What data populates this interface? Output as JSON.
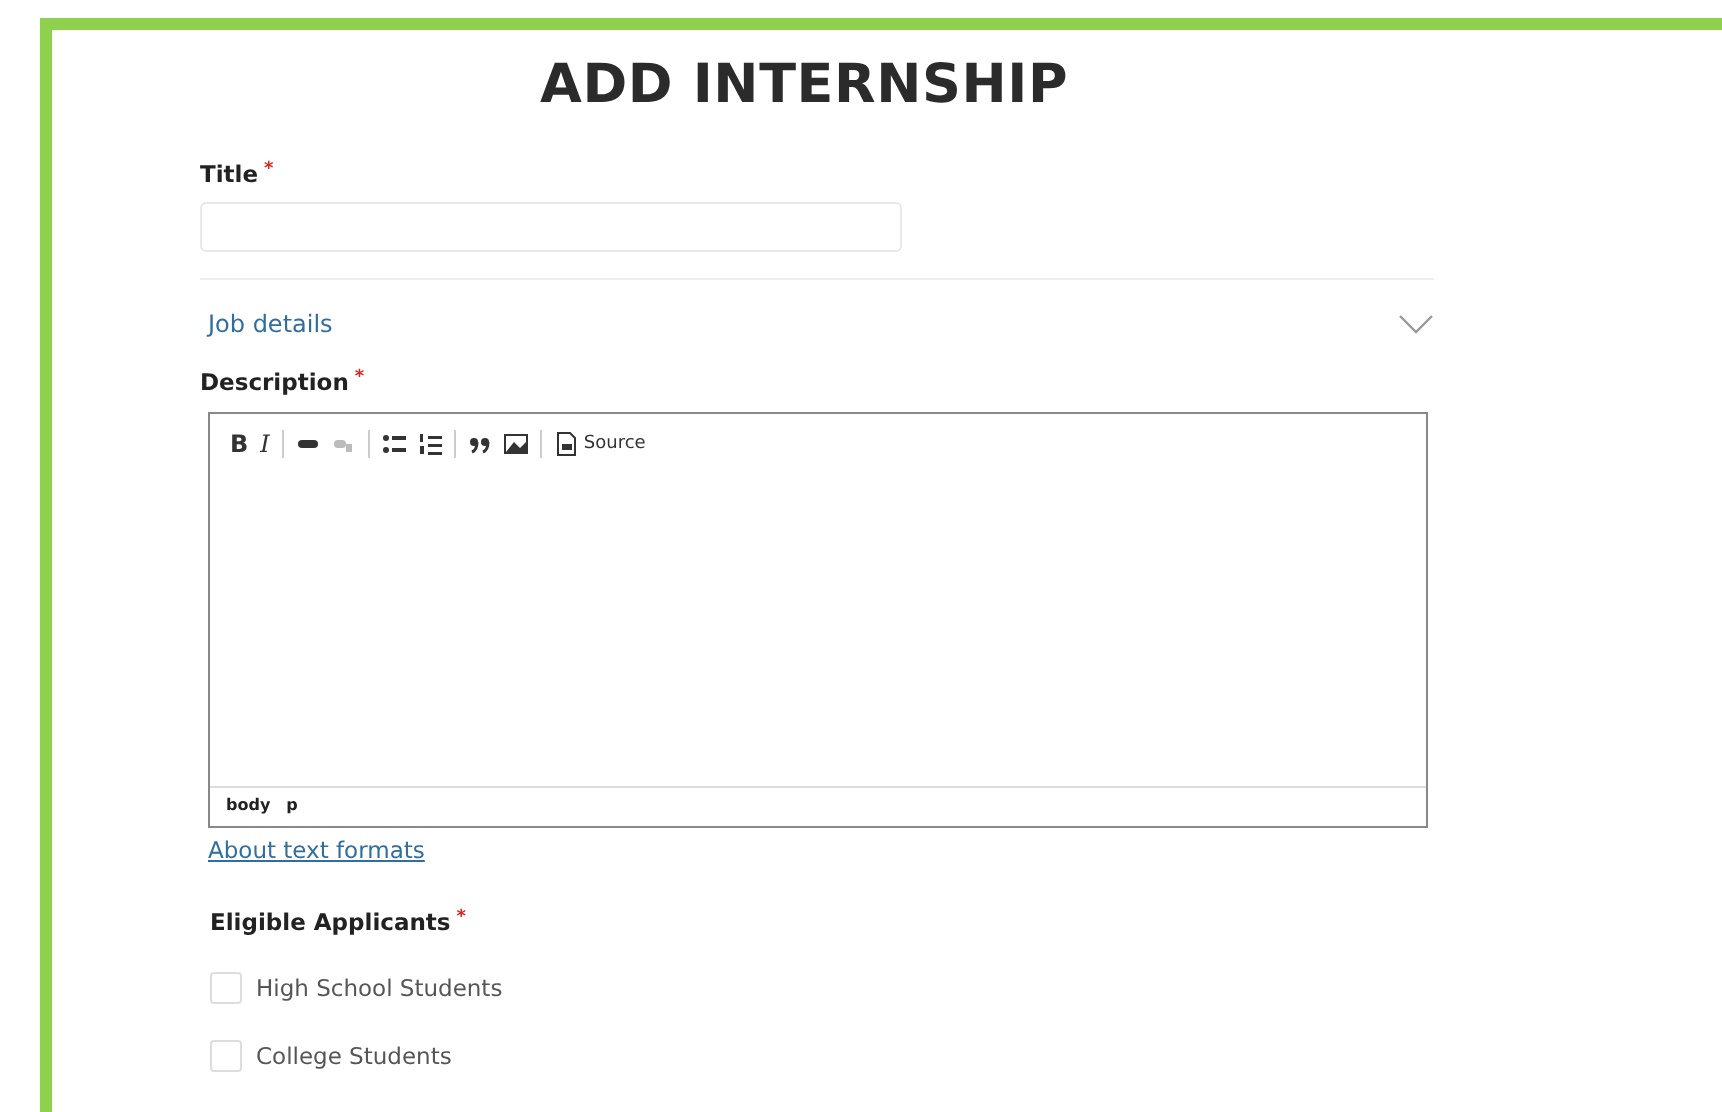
{
  "heading": "ADD INTERNSHIP",
  "title_field": {
    "label": "Title",
    "required_mark": "*"
  },
  "section": {
    "label": "Job details",
    "expanded": false
  },
  "description": {
    "label": "Description",
    "required_mark": "*",
    "toolbar": [
      {
        "kind": "bold",
        "label": "B",
        "disabled": false
      },
      {
        "kind": "italic",
        "label": "I",
        "disabled": false
      },
      {
        "kind": "separator"
      },
      {
        "kind": "link",
        "disabled": false
      },
      {
        "kind": "unlink",
        "disabled": true
      },
      {
        "kind": "separator"
      },
      {
        "kind": "bullets",
        "disabled": false
      },
      {
        "kind": "numbers",
        "disabled": false
      },
      {
        "kind": "separator"
      },
      {
        "kind": "quote",
        "disabled": false
      },
      {
        "kind": "image",
        "disabled": false
      },
      {
        "kind": "separator"
      },
      {
        "kind": "source",
        "label": "Source",
        "disabled": false
      }
    ],
    "path": [
      "body",
      "p"
    ],
    "help_link": "About text formats"
  },
  "eligible": {
    "label": "Eligible Applicants",
    "required_mark": "*",
    "options": [
      {
        "label": "High School Students",
        "checked": false
      },
      {
        "label": "College Students",
        "checked": false
      }
    ]
  }
}
